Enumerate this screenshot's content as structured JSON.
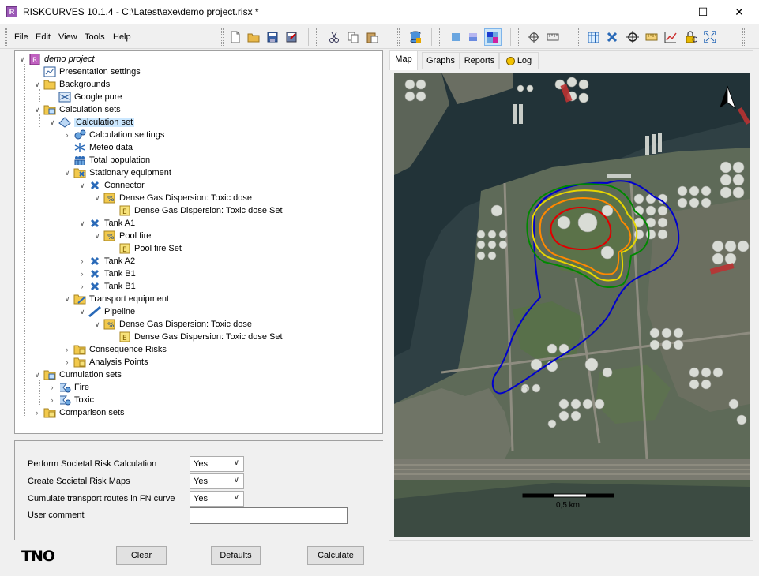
{
  "window": {
    "title": "RISKCURVES 10.1.4 - C:\\Latest\\exe\\demo project.risx *",
    "app_icon_letter": "R",
    "minimize": "—",
    "maximize": "☐",
    "close": "✕"
  },
  "menu": [
    "File",
    "Edit",
    "View",
    "Tools",
    "Help"
  ],
  "tree": {
    "root": "demo project",
    "presentation_settings": "Presentation settings",
    "backgrounds": "Backgrounds",
    "google_pure": "Google pure",
    "calculation_sets": "Calculation sets",
    "calculation_set": "Calculation set",
    "calculation_settings": "Calculation settings",
    "meteo_data": "Meteo data",
    "total_population": "Total population",
    "stationary_equipment": "Stationary equipment",
    "connector": "Connector",
    "dgd_toxic_dose_1": "Dense Gas Dispersion: Toxic dose",
    "dgd_toxic_dose_set_1": "Dense Gas Dispersion: Toxic dose Set",
    "tank_a1": "Tank A1",
    "pool_fire": "Pool fire",
    "pool_fire_set": "Pool fire Set",
    "tank_a2": "Tank A2",
    "tank_b1_a": "Tank B1",
    "tank_b1_b": "Tank B1",
    "transport_equipment": "Transport equipment",
    "pipeline": "Pipeline",
    "dgd_toxic_dose_2": "Dense Gas Dispersion: Toxic dose",
    "dgd_toxic_dose_set_2": "Dense Gas Dispersion: Toxic dose Set",
    "consequence_risks": "Consequence Risks",
    "analysis_points": "Analysis Points",
    "cumulation_sets": "Cumulation sets",
    "fire": "Fire",
    "toxic": "Toxic",
    "comparison_sets": "Comparison sets"
  },
  "settings": {
    "societal_risk_label": "Perform Societal Risk Calculation",
    "societal_risk_value": "Yes",
    "societal_maps_label": "Create Societal Risk Maps",
    "societal_maps_value": "Yes",
    "cumulate_label": "Cumulate transport routes in FN curve",
    "cumulate_value": "Yes",
    "comment_label": "User comment",
    "comment_value": ""
  },
  "footer": {
    "logo": "TNO",
    "clear": "Clear",
    "defaults": "Defaults",
    "calculate": "Calculate"
  },
  "tabs": {
    "map": "Map",
    "graphs": "Graphs",
    "reports": "Reports",
    "log": "Log"
  },
  "map": {
    "scale_label": "0,5 km",
    "contour_colors": [
      "#0000cc",
      "#008800",
      "#e6d600",
      "#ff8800",
      "#e00000"
    ]
  }
}
